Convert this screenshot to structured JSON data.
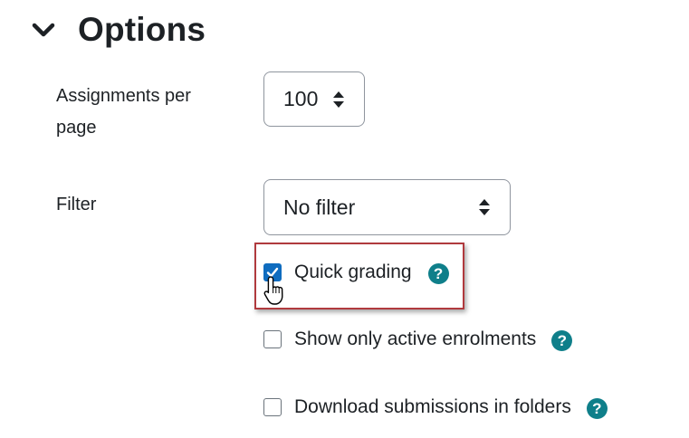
{
  "section": {
    "title": "Options",
    "toggle_icon": "chevron-down-icon"
  },
  "assignments_per_page": {
    "label": "Assignments per page",
    "value": "100"
  },
  "filter": {
    "label": "Filter",
    "value": "No filter"
  },
  "checkboxes": [
    {
      "label": "Quick grading",
      "checked": true,
      "help_glyph": "?"
    },
    {
      "label": "Show only active enrolments",
      "checked": false,
      "help_glyph": "?"
    },
    {
      "label": "Download submissions in folders",
      "checked": false,
      "help_glyph": "?"
    }
  ],
  "colors": {
    "accent": "#0f6cbf",
    "help": "#0f7f8a",
    "highlight_border": "#b03a3e",
    "text": "#1d2125"
  }
}
